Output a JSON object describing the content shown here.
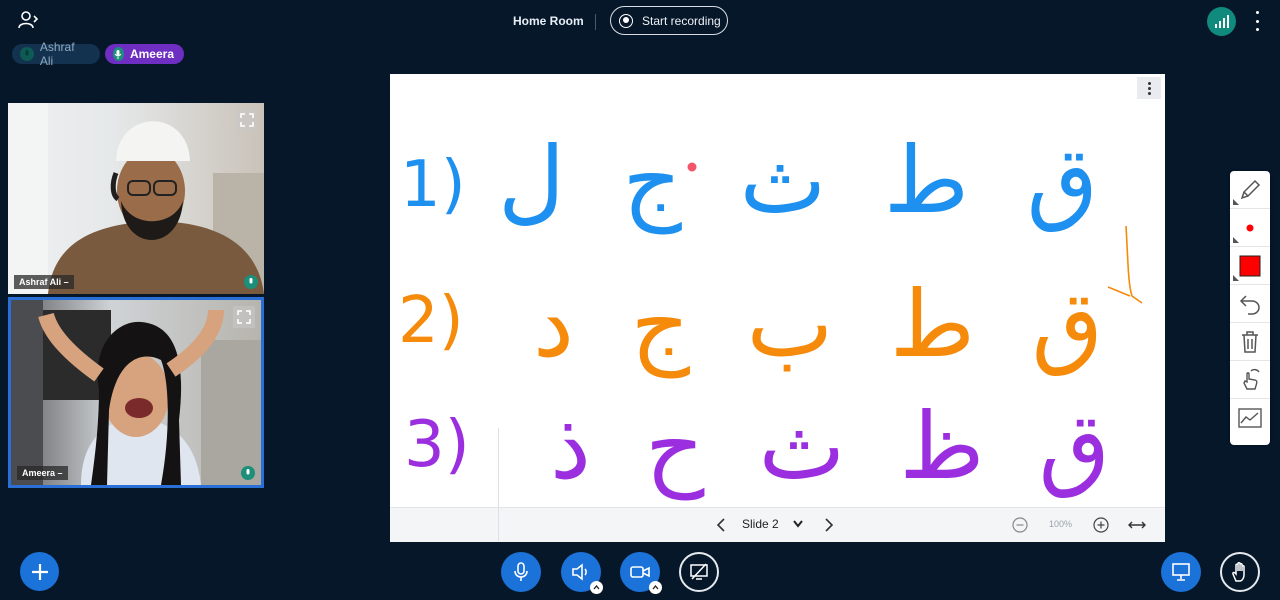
{
  "topbar": {
    "room_title": "Home Room",
    "record_label": "Start recording"
  },
  "talkers": [
    {
      "name": "Ashraf Ali"
    },
    {
      "name": "Ameera"
    }
  ],
  "videos": [
    {
      "name": "Ashraf Ali –"
    },
    {
      "name": "Ameera –"
    }
  ],
  "whiteboard": {
    "row1": {
      "number": "1)",
      "letters": "ق ط ث ج ل",
      "color": "#1e90ef"
    },
    "row2": {
      "number": "2)",
      "letters": "ق ط ب ج د",
      "color": "#f58a0b"
    },
    "row3": {
      "number": "3)",
      "letters": "ق ظ ث ح ذ",
      "color": "#9b2fe0"
    }
  },
  "slide_nav": {
    "current": "Slide 2",
    "zoom": "100%"
  },
  "annotation_tools": [
    {
      "name": "pencil-tool"
    },
    {
      "name": "thickness-tool"
    },
    {
      "name": "color-tool",
      "color": "#ff0000"
    },
    {
      "name": "undo-tool"
    },
    {
      "name": "clear-tool"
    },
    {
      "name": "multi-user-tool"
    },
    {
      "name": "smooth-tool"
    }
  ],
  "colors": {
    "background": "#06172a",
    "primary": "#1b72d8",
    "talking": "#6d2ec1",
    "connection": "#0f8a7d"
  }
}
